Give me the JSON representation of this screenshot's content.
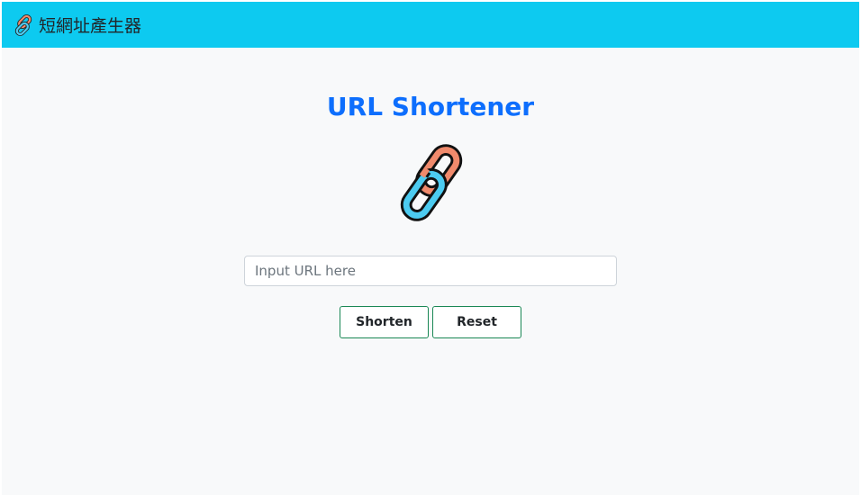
{
  "navbar": {
    "brand_text": "短網址產生器",
    "brand_icon": "link-icon",
    "background": "#0dcaf0"
  },
  "main": {
    "title": "URL Shortener",
    "title_color": "#0d6efd",
    "hero_icon": "link-icon",
    "input": {
      "value": "",
      "placeholder": "Input URL here"
    },
    "buttons": {
      "shorten_label": "Shorten",
      "reset_label": "Reset",
      "border_color": "#198754"
    }
  }
}
